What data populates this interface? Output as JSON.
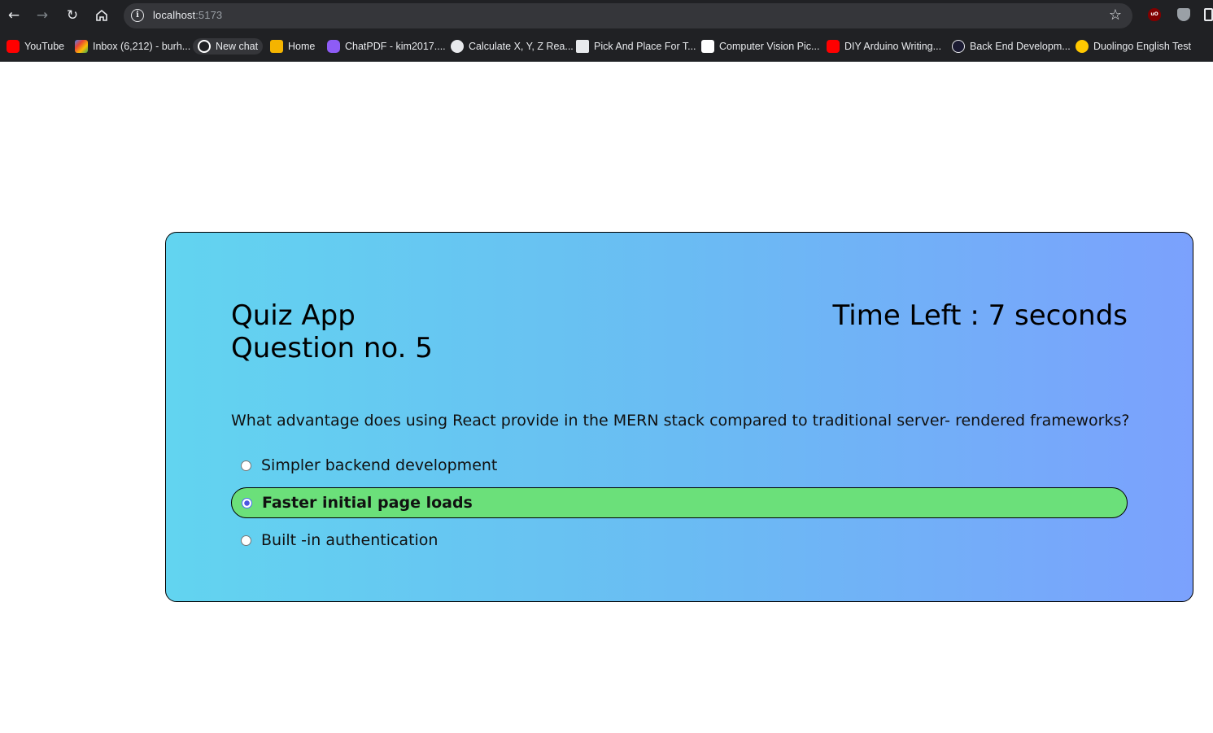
{
  "browser": {
    "url_host": "localhost",
    "url_port": ":5173",
    "back_icon": "arrow-left-icon",
    "forward_icon": "arrow-right-icon",
    "reload_icon": "reload-icon",
    "home_icon": "home-icon"
  },
  "bookmarks": [
    {
      "label": "YouTube",
      "color": "#ff0000"
    },
    {
      "label": "Inbox (6,212) - burh...",
      "color": "#ea4335"
    },
    {
      "label": "New chat",
      "color": "#ffffff"
    },
    {
      "label": "Home",
      "color": "#f4b400"
    },
    {
      "label": "ChatPDF - kim2017....",
      "color": "#8e5cf6"
    },
    {
      "label": "Calculate X, Y, Z Rea...",
      "color": "#ffffff"
    },
    {
      "label": "Pick And Place For T...",
      "color": "#ffffff"
    },
    {
      "label": "Computer Vision Pic...",
      "color": "#ffffff"
    },
    {
      "label": "DIY Arduino Writing...",
      "color": "#ff0000"
    },
    {
      "label": "Back End Developm...",
      "color": "#1b1b32"
    },
    {
      "label": "Duolingo English Test",
      "color": "#ffc800"
    }
  ],
  "quiz": {
    "app_title": "Quiz App",
    "question_no": "Question no. 5",
    "timer_text": "Time Left : 7 seconds",
    "question": "What advantage does using React provide in the MERN stack compared to traditional server- rendered frameworks?",
    "options": [
      {
        "label": "Simpler backend development",
        "selected": false
      },
      {
        "label": "Faster initial page loads",
        "selected": true
      },
      {
        "label": "Built -in authentication",
        "selected": false
      }
    ],
    "selected_color": "#6be07a"
  }
}
